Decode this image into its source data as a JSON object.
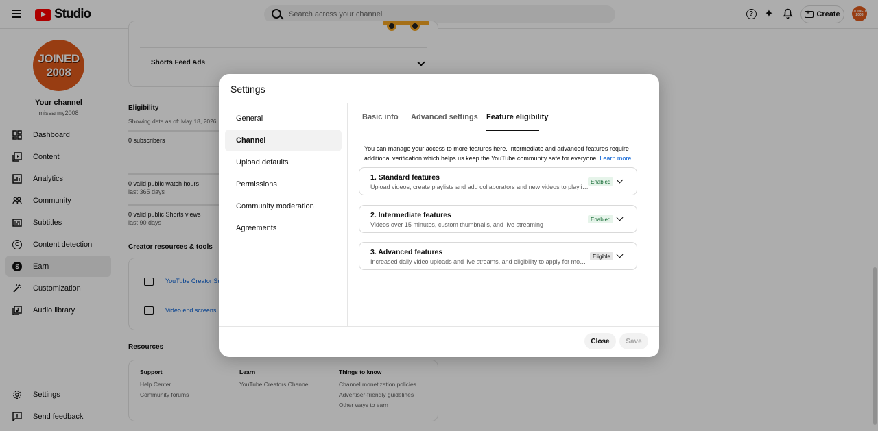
{
  "topbar": {
    "brand": "Studio",
    "search_placeholder": "Search across your channel",
    "create_label": "Create",
    "avatar_text": "JOINED 2008"
  },
  "sidebar": {
    "avatar_line1": "JOINED",
    "avatar_line2": "2008",
    "channel_title": "Your channel",
    "channel_handle": "missanny2008",
    "items": [
      {
        "label": "Dashboard",
        "icon": "dashboard-icon"
      },
      {
        "label": "Content",
        "icon": "content-icon"
      },
      {
        "label": "Analytics",
        "icon": "analytics-icon"
      },
      {
        "label": "Community",
        "icon": "community-icon"
      },
      {
        "label": "Subtitles",
        "icon": "subtitles-icon"
      },
      {
        "label": "Content detection",
        "icon": "copyright-icon"
      },
      {
        "label": "Earn",
        "icon": "dollar-icon",
        "active": true
      },
      {
        "label": "Customization",
        "icon": "magic-wand-icon"
      },
      {
        "label": "Audio library",
        "icon": "audio-library-icon"
      }
    ],
    "settings_label": "Settings",
    "feedback_label": "Send feedback"
  },
  "main": {
    "shorts_feed_ads": "Shorts Feed Ads",
    "eligibility_title": "Eligibility",
    "showing_data": "Showing data as of: May 18, 2026",
    "subscribers": "0 subscribers",
    "watch_hours": "0 valid public watch hours",
    "watch_hours_period": "last 365 days",
    "shorts_views": "0 valid public Shorts views",
    "shorts_views_period": "last 90 days",
    "creator_resources_title": "Creator resources & tools",
    "creator_support_link": "YouTube Creator Sup",
    "video_end_screens_link": "Video end screens",
    "resources_title": "Resources",
    "resources_columns": [
      {
        "title": "Support",
        "links": [
          "Help Center",
          "Community forums"
        ]
      },
      {
        "title": "Learn",
        "links": [
          "YouTube Creators Channel"
        ]
      },
      {
        "title": "Things to know",
        "links": [
          "Channel monetization policies",
          "Advertiser-friendly guidelines",
          "Other ways to earn"
        ]
      }
    ]
  },
  "dialog": {
    "title": "Settings",
    "nav": [
      {
        "label": "General"
      },
      {
        "label": "Channel",
        "active": true
      },
      {
        "label": "Upload defaults"
      },
      {
        "label": "Permissions"
      },
      {
        "label": "Community moderation"
      },
      {
        "label": "Agreements"
      }
    ],
    "tabs": [
      {
        "label": "Basic info"
      },
      {
        "label": "Advanced settings"
      },
      {
        "label": "Feature eligibility",
        "active": true
      }
    ],
    "intro": "You can manage your access to more features here. Intermediate and advanced features require additional verification which helps us keep the YouTube community safe for everyone.",
    "learn_more": "Learn more",
    "features": [
      {
        "title": "1. Standard features",
        "desc": "Upload videos, create playlists and add collaborators and new videos to playlists",
        "status": "Enabled"
      },
      {
        "title": "2. Intermediate features",
        "desc": "Videos over 15 minutes, custom thumbnails, and live streaming",
        "status": "Enabled"
      },
      {
        "title": "3. Advanced features",
        "desc": "Increased daily video uploads and live streams, and eligibility to apply for monetization",
        "status": "Eligible"
      }
    ],
    "close_label": "Close",
    "save_label": "Save"
  },
  "colors": {
    "brand_red": "#ff0000",
    "avatar_orange": "#e05a1b",
    "link_blue": "#065fd4",
    "enabled_bg": "#e6f4ea",
    "enabled_text": "#0d652d"
  }
}
